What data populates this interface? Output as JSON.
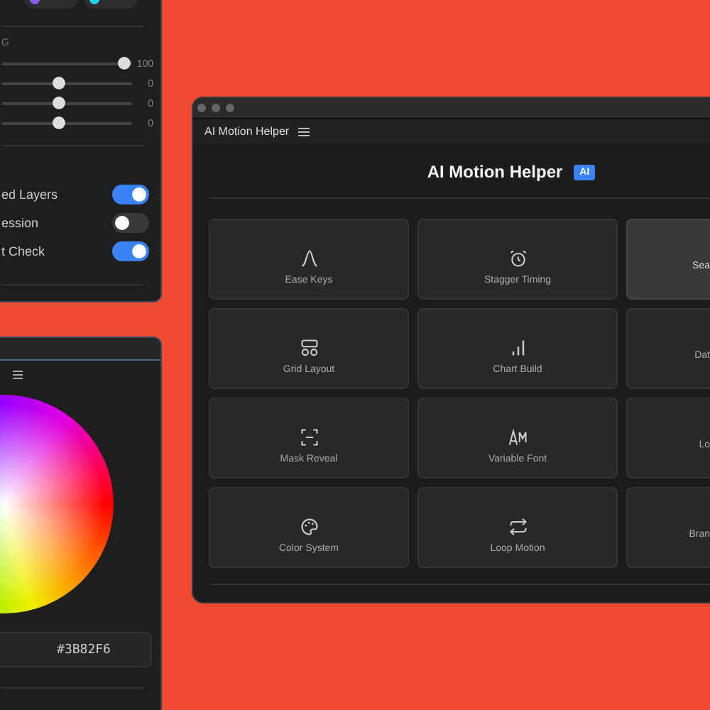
{
  "settings_panel": {
    "chips": [
      {
        "color": "#8b5cf6"
      },
      {
        "color": "#22d3ee"
      }
    ],
    "section_label": "G",
    "sliders": [
      {
        "level": 1,
        "reading": "100"
      },
      {
        "level": 0.44,
        "reading": "0"
      },
      {
        "level": 0.44,
        "reading": "0"
      },
      {
        "level": 0.44,
        "reading": "0"
      }
    ],
    "toggles": [
      {
        "label": "ed Layers",
        "on": true
      },
      {
        "label": "ession",
        "on": false
      },
      {
        "label": "t Check",
        "on": true
      }
    ]
  },
  "color_panel": {
    "hex": "#3B82F6"
  },
  "main_window": {
    "title": "AI Motion Helper",
    "heading": "AI Motion Helper",
    "badge": "AI",
    "cards": [
      {
        "label": "Ease Keys",
        "kind": "ease",
        "selected": false
      },
      {
        "label": "Stagger Timing",
        "kind": "clock",
        "selected": false
      },
      {
        "label": "Sea",
        "kind": "cut",
        "selected": true
      },
      {
        "label": "Grid Layout",
        "kind": "grid",
        "selected": false
      },
      {
        "label": "Chart Build",
        "kind": "chart",
        "selected": false
      },
      {
        "label": "Dat",
        "kind": "cut",
        "selected": false
      },
      {
        "label": "Mask Reveal",
        "kind": "mask",
        "selected": false
      },
      {
        "label": "Variable Font",
        "kind": "font",
        "selected": false
      },
      {
        "label": "Lo",
        "kind": "cut",
        "selected": false
      },
      {
        "label": "Color System",
        "kind": "palette",
        "selected": false
      },
      {
        "label": "Loop Motion",
        "kind": "loop",
        "selected": false
      },
      {
        "label": "Bran",
        "kind": "cut",
        "selected": false
      }
    ]
  }
}
